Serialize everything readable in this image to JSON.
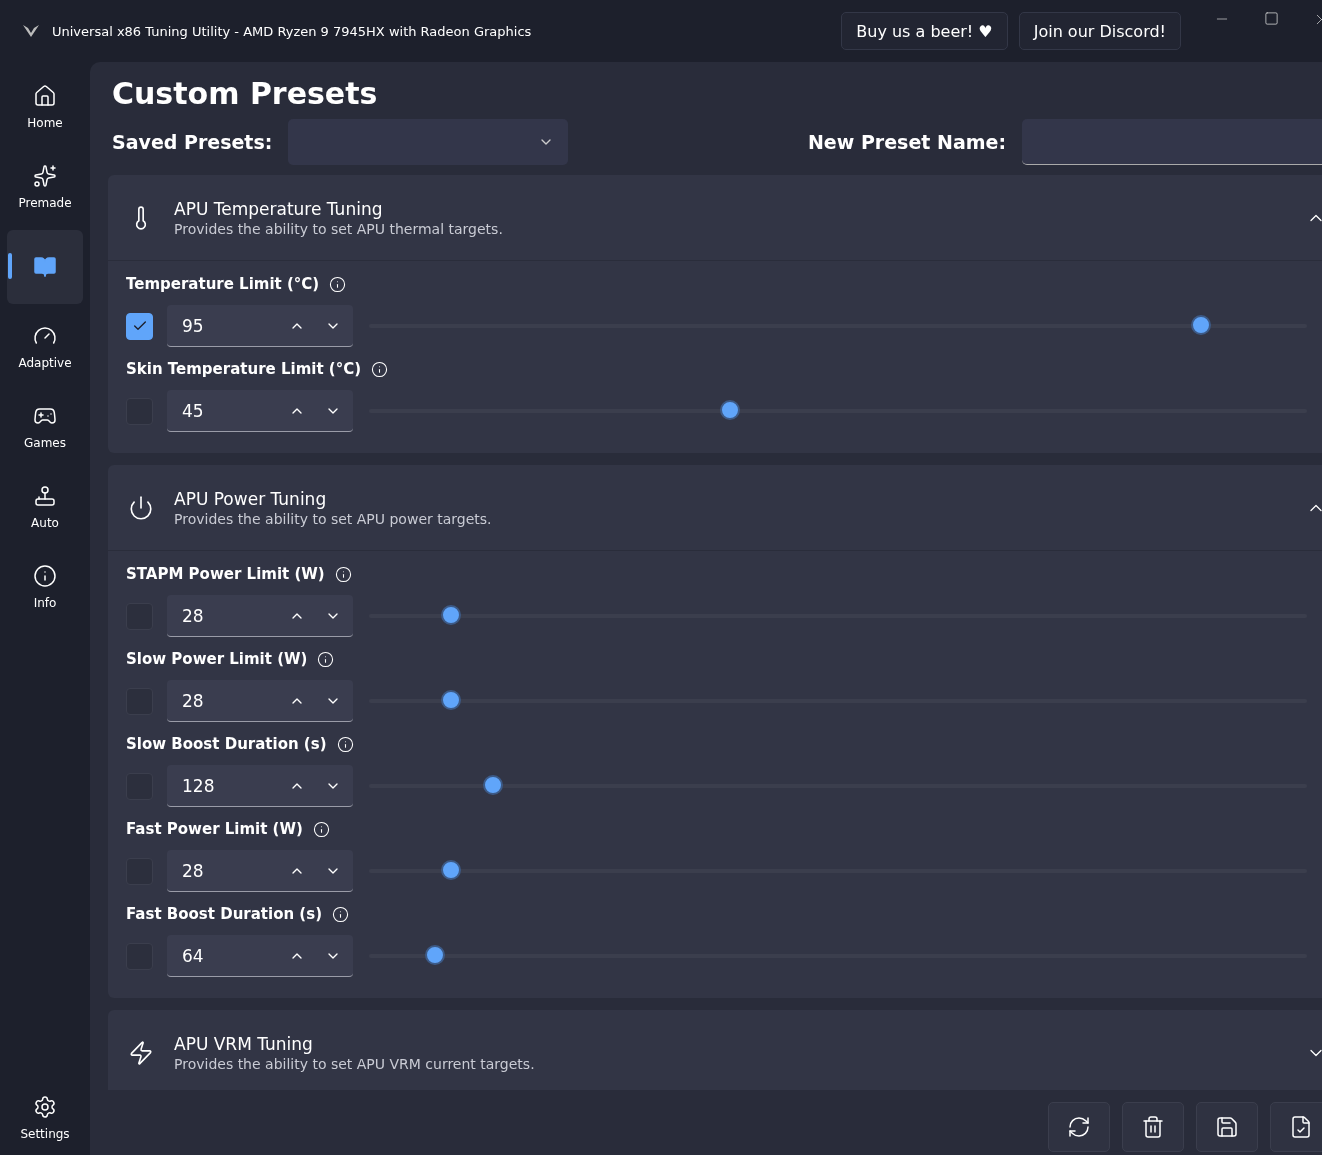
{
  "window": {
    "title": "Universal x86 Tuning Utility - AMD Ryzen 9 7945HX with Radeon Graphics"
  },
  "header_buttons": [
    "Buy us a beer! ♥",
    "Join our Discord!"
  ],
  "sidebar": {
    "items": [
      {
        "kind": "home",
        "label": "Home",
        "selected": false
      },
      {
        "kind": "premade",
        "label": "Premade",
        "selected": false
      },
      {
        "kind": "custom",
        "selected": true
      },
      {
        "kind": "adaptive",
        "label": "Adaptive",
        "selected": false
      },
      {
        "kind": "games",
        "label": "Games",
        "selected": false
      },
      {
        "kind": "auto",
        "label": "Auto",
        "selected": false
      },
      {
        "kind": "info",
        "label": "Info",
        "selected": false
      }
    ],
    "footer": {
      "kind": "settings",
      "label": "Settings",
      "selected": false
    }
  },
  "page": {
    "title": "Custom Presets",
    "saved_presets_label": "Saved Presets:",
    "new_preset_label": "New Preset Name:"
  },
  "sections": [
    {
      "kind": "thermal",
      "title": "APU Temperature Tuning",
      "description": "Provides the ability to set APU thermal targets.",
      "expanded": true,
      "settings": [
        {
          "label": "Temperature Limit (°C)",
          "checked": true,
          "value": "95",
          "level": 0.887
        },
        {
          "label": "Skin Temperature Limit (°C)",
          "checked": false,
          "value": "45",
          "level": 0.385
        }
      ]
    },
    {
      "kind": "power",
      "title": "APU Power Tuning",
      "description": "Provides the ability to set APU power targets.",
      "expanded": true,
      "settings": [
        {
          "label": "STAPM Power Limit (W)",
          "checked": false,
          "value": "28",
          "level": 0.087
        },
        {
          "label": "Slow Power Limit (W)",
          "checked": false,
          "value": "28",
          "level": 0.087
        },
        {
          "label": "Slow Boost Duration (s)",
          "checked": false,
          "value": "128",
          "level": 0.132
        },
        {
          "label": "Fast Power Limit (W)",
          "checked": false,
          "value": "28",
          "level": 0.087
        },
        {
          "label": "Fast Boost Duration (s)",
          "checked": false,
          "value": "64",
          "level": 0.07
        }
      ]
    },
    {
      "kind": "vrm",
      "title": "APU VRM Tuning",
      "description": "Provides the ability to set APU VRM current targets.",
      "expanded": false
    }
  ],
  "actions": [
    {
      "kind": "reload"
    },
    {
      "kind": "delete"
    },
    {
      "kind": "save"
    },
    {
      "kind": "apply"
    }
  ]
}
